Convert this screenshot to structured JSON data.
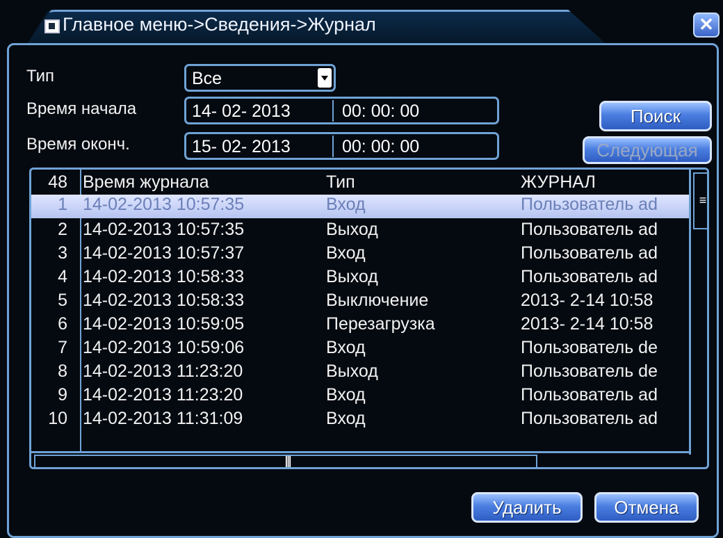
{
  "title": {
    "text": "Главное меню->Сведения->Журнал",
    "close_label": "✕"
  },
  "filters": {
    "type_label": "Тип",
    "type_value": "Все",
    "start_label": "Время начала",
    "start_date": "14- 02- 2013",
    "start_time": "00: 00: 00",
    "end_label": "Время оконч.",
    "end_date": "15- 02- 2013",
    "end_time": "00: 00: 00"
  },
  "buttons": {
    "search": "Поиск",
    "next": "Следующая",
    "delete": "Удалить",
    "cancel": "Отмена"
  },
  "table": {
    "headers": {
      "count": "48",
      "time": "Время журнала",
      "type": "Тип",
      "log": "ЖУРНАЛ"
    },
    "rows": [
      {
        "num": "1",
        "time": "14-02-2013 10:57:35",
        "type": "Вход",
        "log": "Пользователь ad"
      },
      {
        "num": "2",
        "time": "14-02-2013 10:57:35",
        "type": "Выход",
        "log": "Пользователь ad"
      },
      {
        "num": "3",
        "time": "14-02-2013 10:57:37",
        "type": "Вход",
        "log": "Пользователь ad"
      },
      {
        "num": "4",
        "time": "14-02-2013 10:58:33",
        "type": "Выход",
        "log": "Пользователь ad"
      },
      {
        "num": "5",
        "time": "14-02-2013 10:58:33",
        "type": "Выключение",
        "log": "2013- 2-14 10:58"
      },
      {
        "num": "6",
        "time": "14-02-2013 10:59:05",
        "type": "Перезагрузка",
        "log": "2013- 2-14 10:58"
      },
      {
        "num": "7",
        "time": "14-02-2013 10:59:06",
        "type": "Вход",
        "log": "Пользователь de"
      },
      {
        "num": "8",
        "time": "14-02-2013 11:23:20",
        "type": "Выход",
        "log": "Пользователь de"
      },
      {
        "num": "9",
        "time": "14-02-2013 11:23:20",
        "type": "Вход",
        "log": "Пользователь ad"
      },
      {
        "num": "10",
        "time": "14-02-2013 11:31:09",
        "type": "Вход",
        "log": "Пользователь ad"
      }
    ],
    "selected_row": 1
  },
  "colors": {
    "border": "#6fa3d6",
    "background": "#050a10",
    "selected_row": "#c8d4f8",
    "button": "#4a7ee0"
  }
}
